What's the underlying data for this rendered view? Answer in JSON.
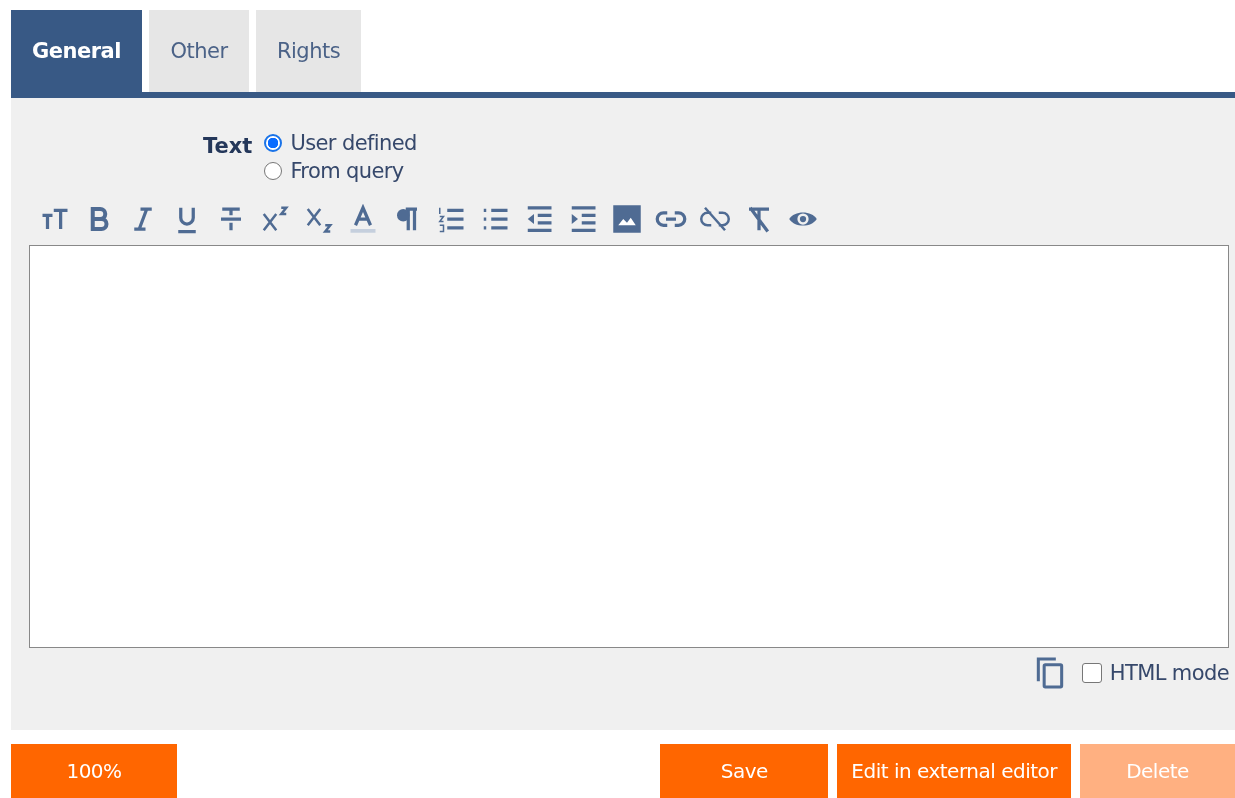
{
  "tabs": [
    {
      "label": "General",
      "selected": true
    },
    {
      "label": "Other",
      "selected": false
    },
    {
      "label": "Rights",
      "selected": false
    }
  ],
  "text_source": {
    "label": "Text",
    "options": [
      {
        "label": "User defined",
        "selected": true
      },
      {
        "label": "From query",
        "selected": false
      }
    ]
  },
  "html_mode": {
    "label": "HTML mode",
    "checked": false
  },
  "zoom_button": "100%",
  "buttons": [
    {
      "label": "Save",
      "disabled": false
    },
    {
      "label": "Edit in external editor",
      "disabled": false
    },
    {
      "label": "Delete",
      "disabled": true
    }
  ]
}
